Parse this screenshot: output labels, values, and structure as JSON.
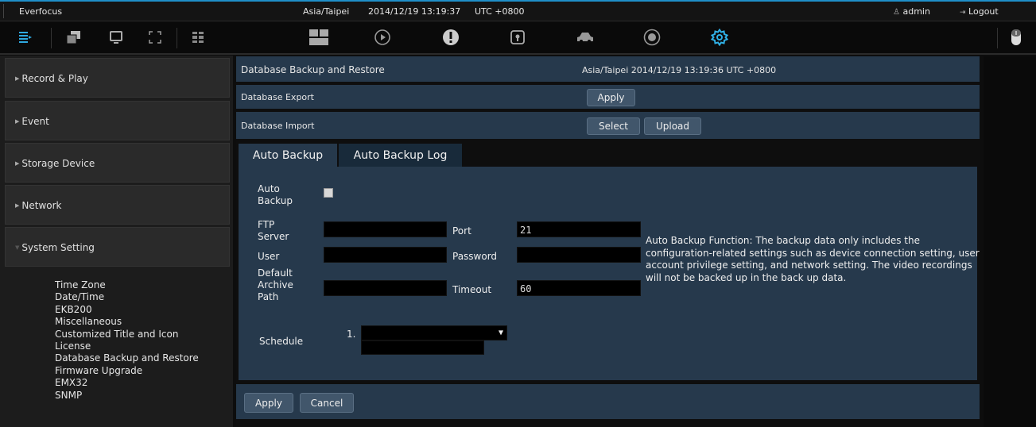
{
  "header": {
    "brand": "Everfocus",
    "timezone": "Asia/Taipei",
    "datetime": "2014/12/19 13:19:37",
    "utc": "UTC +0800",
    "user": "admin",
    "logout": "Logout"
  },
  "iconbar": {
    "left_icons": [
      "menu-list-icon",
      "windows-icon",
      "monitor-icon",
      "fullscreen-icon",
      "grid-split-icon"
    ],
    "center_icons": [
      "layout-icon",
      "playback-icon",
      "alert-icon",
      "lock-icon",
      "car-icon",
      "face-icon",
      "gear-icon"
    ],
    "right_icons": [
      "mouse-icon"
    ],
    "accent": "#1f8fc9"
  },
  "sidebar": {
    "items": [
      {
        "label": "Record & Play"
      },
      {
        "label": "Event"
      },
      {
        "label": "Storage Device"
      },
      {
        "label": "Network"
      },
      {
        "label": "System Setting"
      }
    ],
    "submenu": [
      "Time Zone",
      "Date/Time",
      "EKB200",
      "Miscellaneous",
      "Customized Title and Icon",
      "License",
      "Database Backup and Restore",
      "Firmware Upgrade",
      "EMX32",
      "SNMP"
    ]
  },
  "main": {
    "title": "Database Backup and Restore",
    "timestamp": "Asia/Taipei 2014/12/19 13:19:36 UTC +0800",
    "export_label": "Database Export",
    "export_apply": "Apply",
    "import_label": "Database Import",
    "import_select": "Select",
    "import_upload": "Upload",
    "tabs": [
      "Auto Backup",
      "Auto Backup Log"
    ],
    "form": {
      "auto_backup_label_1": "Auto",
      "auto_backup_label_2": "Backup",
      "ftp_label_1": "FTP",
      "ftp_label_2": "Server",
      "ftp_value": "",
      "port_label": "Port",
      "port_value": "21",
      "user_label": "User",
      "user_value": "",
      "password_label": "Password",
      "password_value": "",
      "archive_label_1": "Default",
      "archive_label_2": "Archive",
      "archive_label_3": "Path",
      "archive_value": "",
      "timeout_label": "Timeout",
      "timeout_value": "60",
      "schedule_label": "Schedule",
      "schedule_index": "1."
    },
    "note": "Auto Backup Function: The backup data only includes the configuration-related settings such as device connection setting, user account privilege setting, and network setting. The video recordings will not be backed up in the back up data.",
    "apply": "Apply",
    "cancel": "Cancel"
  }
}
